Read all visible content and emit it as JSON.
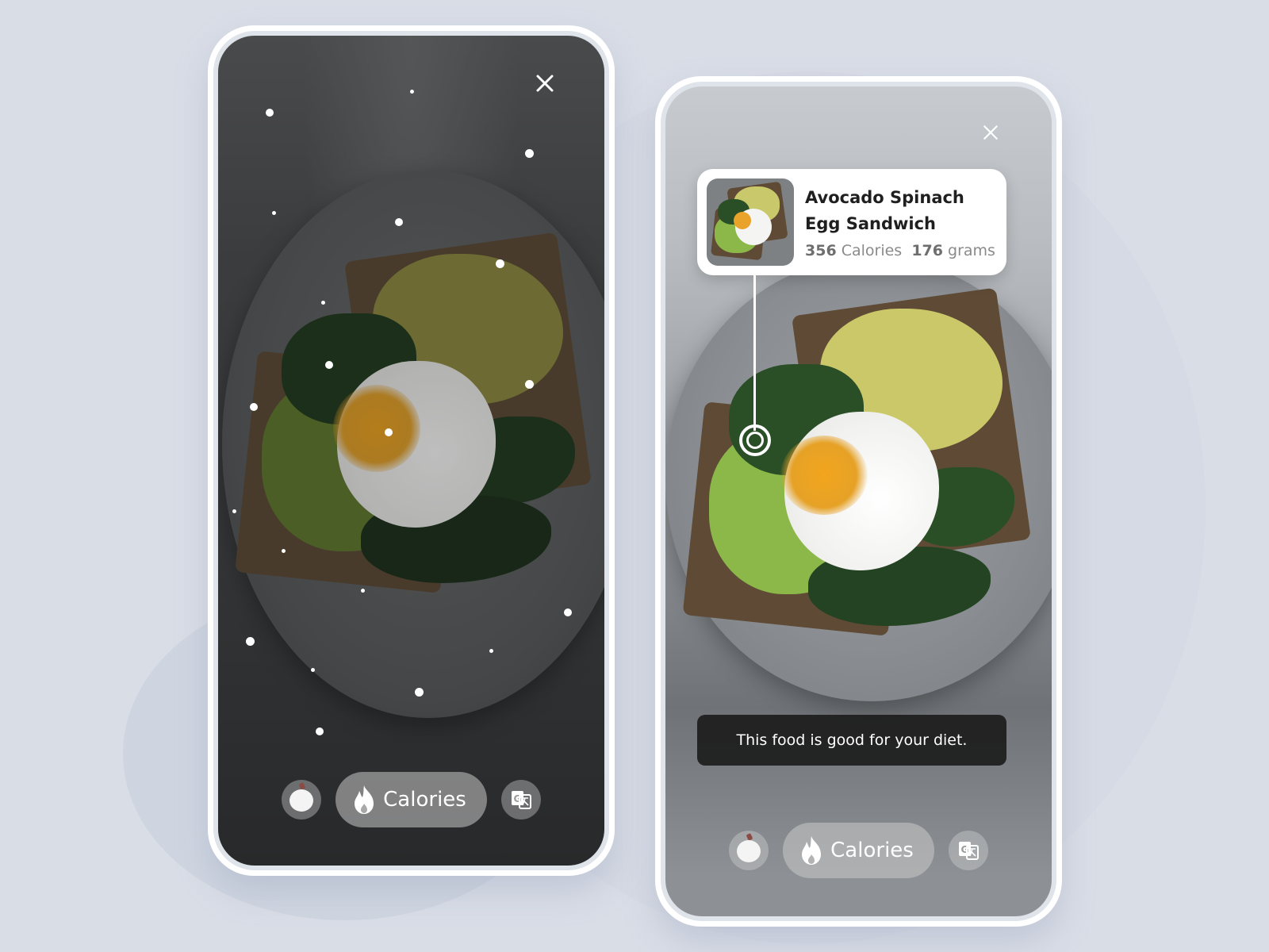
{
  "screens": [
    {
      "id": "scanning",
      "close_icon": "close-icon",
      "bottom_bar": {
        "left_button_icon": "apple-icon",
        "primary_button": {
          "icon": "flame-icon",
          "label": "Calories"
        },
        "right_button_icon": "translate-icon"
      }
    },
    {
      "id": "result",
      "close_icon": "close-icon",
      "result_card": {
        "title_line1": "Avocado Spinach",
        "title_line2": "Egg Sandwich",
        "calories_value": "356",
        "calories_unit": "Calories",
        "weight_value": "176",
        "weight_unit": "grams"
      },
      "diet_message": "This food is good for your diet.",
      "bottom_bar": {
        "left_button_icon": "apple-icon",
        "primary_button": {
          "icon": "flame-icon",
          "label": "Calories"
        },
        "right_button_icon": "translate-icon"
      }
    }
  ],
  "colors": {
    "background": "#d9dde6",
    "frame": "#ffffff",
    "card": "#ffffff",
    "banner": "#1c1c1c"
  }
}
